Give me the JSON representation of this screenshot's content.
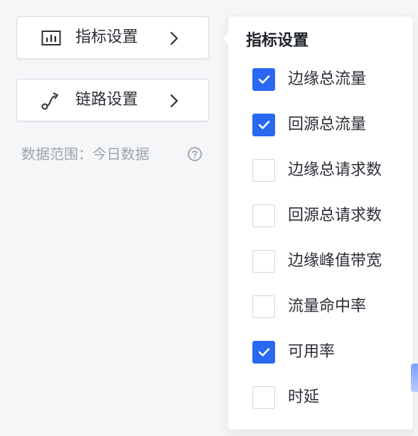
{
  "sidebar": {
    "metrics_button": {
      "label": "指标设置",
      "icon": "bar-chart-icon"
    },
    "link_button": {
      "label": "链路设置",
      "icon": "route-icon"
    },
    "data_range": "数据范围：今日数据"
  },
  "popover": {
    "title": "指标设置",
    "options": [
      {
        "label": "边缘总流量",
        "checked": true
      },
      {
        "label": "回源总流量",
        "checked": true
      },
      {
        "label": "边缘总请求数",
        "checked": false
      },
      {
        "label": "回源总请求数",
        "checked": false
      },
      {
        "label": "边缘峰值带宽",
        "checked": false
      },
      {
        "label": "流量命中率",
        "checked": false
      },
      {
        "label": "可用率",
        "checked": true
      },
      {
        "label": "时延",
        "checked": false
      }
    ]
  },
  "colors": {
    "accent": "#2a68f2",
    "text": "#2b2f36",
    "muted": "#9ea3ab"
  }
}
